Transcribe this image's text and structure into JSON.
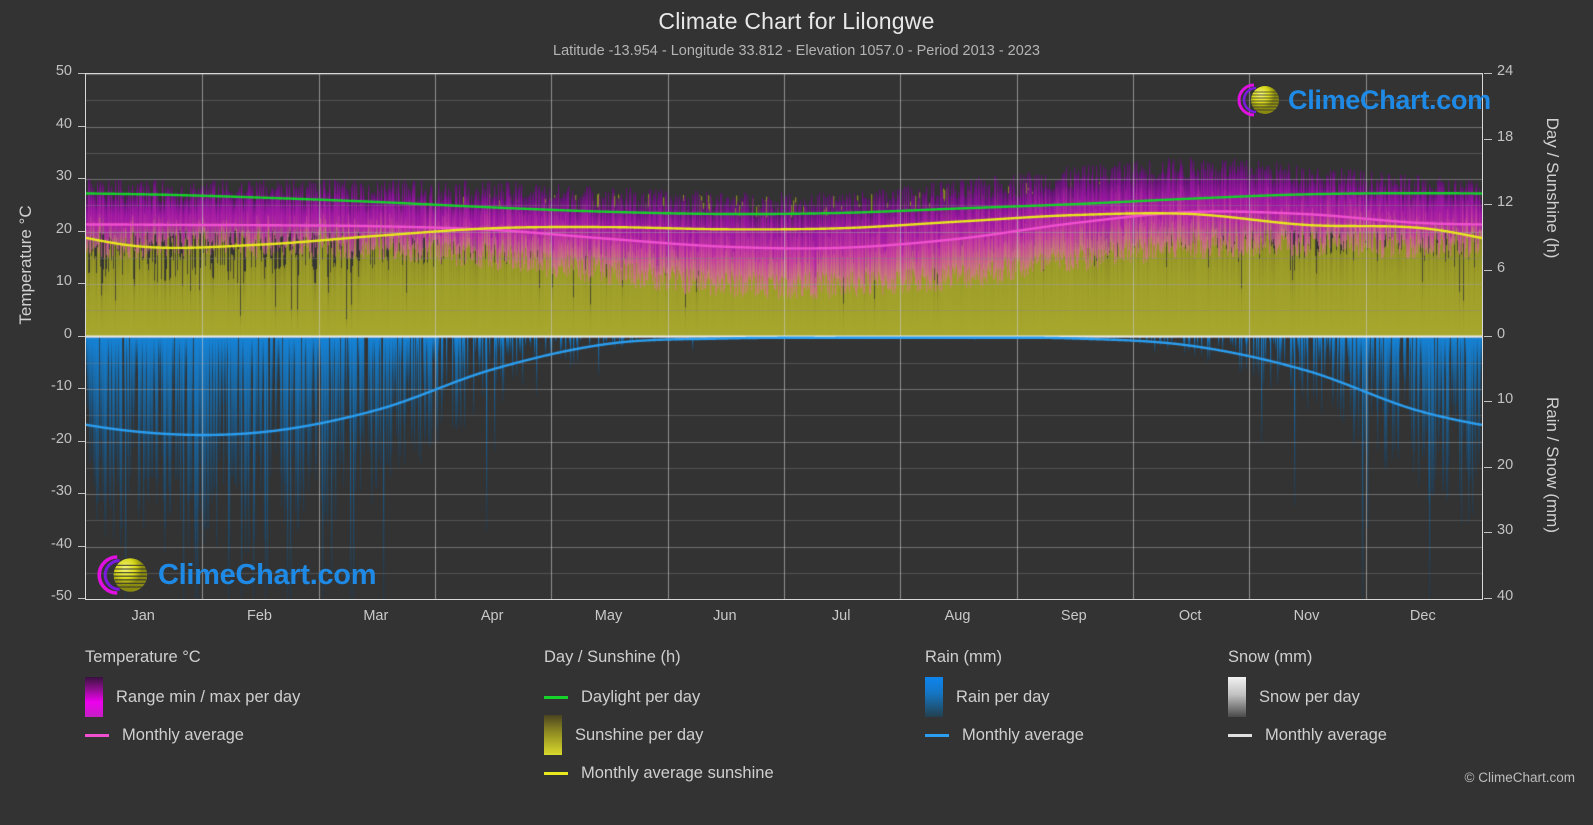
{
  "header": {
    "title": "Climate Chart for Lilongwe",
    "subtitle": "Latitude -13.954 - Longitude 33.812 - Elevation 1057.0 - Period 2013 - 2023"
  },
  "axes": {
    "left_label": "Temperature °C",
    "right_label_top": "Day / Sunshine (h)",
    "right_label_bottom": "Rain / Snow (mm)",
    "left_ticks": [
      "50",
      "40",
      "30",
      "20",
      "10",
      "0",
      "-10",
      "-20",
      "-30",
      "-40",
      "-50"
    ],
    "right_ticks_top": [
      "24",
      "18",
      "12",
      "6",
      "0"
    ],
    "right_ticks_bottom": [
      "10",
      "20",
      "30",
      "40"
    ],
    "x_ticks": [
      "Jan",
      "Feb",
      "Mar",
      "Apr",
      "May",
      "Jun",
      "Jul",
      "Aug",
      "Sep",
      "Oct",
      "Nov",
      "Dec"
    ]
  },
  "legend": {
    "temperature": {
      "title": "Temperature °C",
      "items": [
        {
          "label": "Range min / max per day",
          "swatch": "gradient-magenta",
          "type": "box"
        },
        {
          "label": "Monthly average",
          "swatch": "#f050d0",
          "type": "line"
        }
      ]
    },
    "daysunshine": {
      "title": "Day / Sunshine (h)",
      "items": [
        {
          "label": "Daylight per day",
          "swatch": "#16d22a",
          "type": "line"
        },
        {
          "label": "Sunshine per day",
          "swatch": "gradient-yellow",
          "type": "box"
        },
        {
          "label": "Monthly average sunshine",
          "swatch": "#e8e81e",
          "type": "line"
        }
      ]
    },
    "rain": {
      "title": "Rain (mm)",
      "items": [
        {
          "label": "Rain per day",
          "swatch": "gradient-blue",
          "type": "box"
        },
        {
          "label": "Monthly average",
          "swatch": "#2b9ef0",
          "type": "line"
        }
      ]
    },
    "snow": {
      "title": "Snow (mm)",
      "items": [
        {
          "label": "Snow per day",
          "swatch": "gradient-white",
          "type": "box"
        },
        {
          "label": "Monthly average",
          "swatch": "#e0e0e0",
          "type": "line"
        }
      ]
    }
  },
  "watermark": {
    "text": "ClimeChart.com",
    "copyright": "© ClimeChart.com"
  },
  "colors": {
    "background": "#333333",
    "plot_border": "#d8d8d8",
    "grid": "#9a9a9a",
    "temp_range_hi": "#cc00cc",
    "temp_range_lo": "#e07aa8",
    "temp_avg_line": "#f050d0",
    "daylight_line": "#16d22a",
    "sunshine_fill": "#a5a528",
    "sunshine_avg_line": "#e8e81e",
    "rain_fill": "#1d6fa8",
    "rain_avg_line": "#2b9ef0",
    "text": "#c8c8c8",
    "logo_blue": "#1e8ae6",
    "logo_magenta": "#e010e0",
    "logo_yellow": "#d6d61a"
  },
  "chart_data": {
    "type": "area",
    "title": "Climate Chart for Lilongwe",
    "subtitle": "Latitude -13.954 - Longitude 33.812 - Elevation 1057.0 - Period 2013 - 2023",
    "xlabel": "",
    "ylabel": "Temperature °C",
    "ylabel_right_top": "Day / Sunshine (h)",
    "ylabel_right_bottom": "Rain / Snow (mm)",
    "ylim": [
      -50,
      50
    ],
    "ylim_right_top": [
      0,
      24
    ],
    "ylim_right_bottom": [
      0,
      40
    ],
    "grid": true,
    "legend_position": "below",
    "categories": [
      "Jan",
      "Feb",
      "Mar",
      "Apr",
      "May",
      "Jun",
      "Jul",
      "Aug",
      "Sep",
      "Oct",
      "Nov",
      "Dec"
    ],
    "series": [
      {
        "name": "Temperature monthly average (°C)",
        "color": "#f050d0",
        "values": [
          21.3,
          21.2,
          21.0,
          20.3,
          18.6,
          17.1,
          16.9,
          18.6,
          21.6,
          23.7,
          23.3,
          21.6
        ]
      },
      {
        "name": "Temperature range max per day (°C)",
        "color": "#cc00cc",
        "values": [
          27.5,
          27.5,
          27.5,
          27.2,
          26.2,
          25.2,
          25.3,
          27.5,
          30.1,
          31.8,
          30.4,
          28.2
        ]
      },
      {
        "name": "Temperature range min per day (°C)",
        "color": "#e07aa8",
        "values": [
          17.5,
          17.6,
          17.2,
          15.2,
          12.3,
          10.0,
          9.8,
          11.5,
          14.6,
          17.2,
          17.8,
          17.4
        ]
      },
      {
        "name": "Daylight per day (h)",
        "color": "#16d22a",
        "values": [
          13.0,
          12.7,
          12.3,
          11.8,
          11.4,
          11.2,
          11.3,
          11.7,
          12.1,
          12.6,
          13.0,
          13.1
        ]
      },
      {
        "name": "Monthly average sunshine (h)",
        "color": "#e8e81e",
        "values": [
          8.2,
          8.4,
          9.2,
          9.9,
          10.0,
          9.8,
          9.9,
          10.5,
          11.1,
          11.2,
          10.2,
          9.9
        ]
      },
      {
        "name": "Rain monthly average (mm)",
        "color": "#2b9ef0",
        "values": [
          14.6,
          14.6,
          11.2,
          5.0,
          1.1,
          0.3,
          0.2,
          0.2,
          0.3,
          1.4,
          5.2,
          11.5
        ]
      },
      {
        "name": "Snow monthly average (mm)",
        "color": "#e0e0e0",
        "values": [
          0,
          0,
          0,
          0,
          0,
          0,
          0,
          0,
          0,
          0,
          0,
          0
        ]
      }
    ]
  }
}
